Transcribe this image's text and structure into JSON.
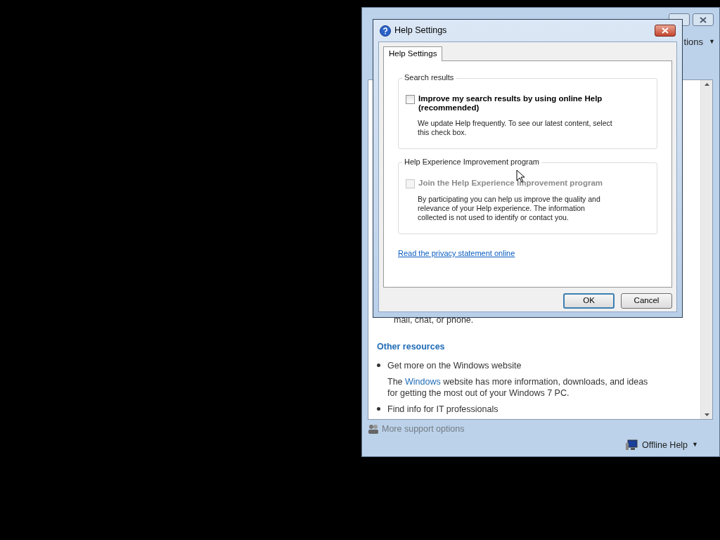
{
  "background_window": {
    "toolbar_partial": "tions",
    "toolbar_caret": "▼",
    "content": {
      "line_partial": "mail, chat, or phone.",
      "heading": "Other resources",
      "items": [
        {
          "title": "Get more on the Windows website",
          "description": [
            {
              "kind": "text",
              "text": "The "
            },
            {
              "kind": "link",
              "text": "Windows"
            },
            {
              "kind": "text",
              "text": " website has more information, downloads, and ideas for getting the most out of your Windows 7 PC."
            }
          ]
        },
        {
          "title": "Find info for IT professionals"
        }
      ]
    },
    "footer": {
      "support_link": {
        "text": "More support options",
        "disabled": true
      },
      "offline": {
        "label": "Offline Help",
        "caret": "▼"
      }
    }
  },
  "dialog": {
    "title": "Help Settings",
    "tabs": [
      {
        "label": "Help Settings",
        "selected": true
      }
    ],
    "groups": [
      {
        "legend": "Search results",
        "checkbox": {
          "label": "Improve my search results by using online Help (recommended)",
          "checked": false,
          "disabled": false
        },
        "description": "We update Help frequently. To see our latest content, select this check box."
      },
      {
        "legend": "Help Experience Improvement program",
        "checkbox": {
          "label": "Join the Help Experience Improvement program",
          "checked": false,
          "disabled": true
        },
        "description": "By participating you can help us improve the quality and relevance of your Help experience. The information collected is not used to identify or contact you."
      }
    ],
    "link": "Read the privacy statement online",
    "buttons": [
      {
        "label": "OK",
        "default": true
      },
      {
        "label": "Cancel",
        "default": false
      }
    ]
  }
}
